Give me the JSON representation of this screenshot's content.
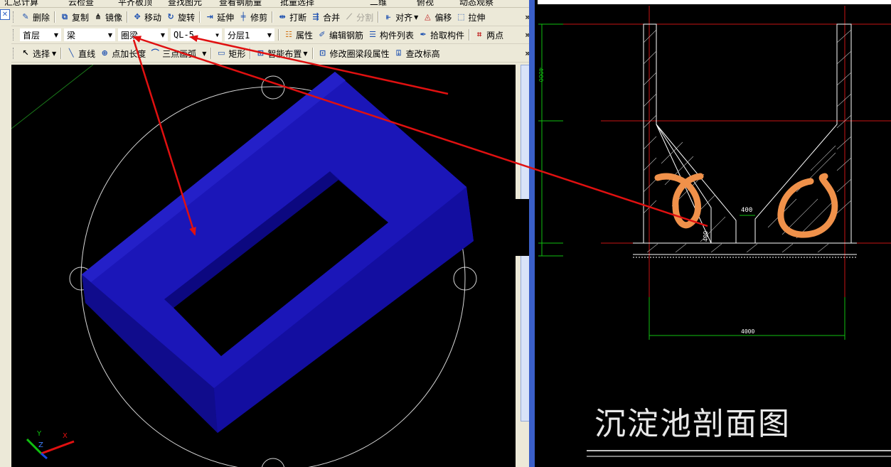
{
  "toolbar_cut": {
    "item1": "汇总计算",
    "item2": "云检查",
    "item3": "平齐板顶",
    "item4": "查找图元",
    "item5": "查看钢筋量",
    "item6": "批量选择",
    "item7": "二维",
    "item8": "俯视",
    "item9": "动态观察"
  },
  "toolbar1": {
    "delete": "删除",
    "copy": "复制",
    "mirror": "镜像",
    "move": "移动",
    "rotate": "旋转",
    "extend": "延伸",
    "trim": "修剪",
    "break": "打断",
    "merge": "合并",
    "split": "分割",
    "align": "对齐",
    "offset": "偏移",
    "stretch": "拉伸"
  },
  "toolbar2": {
    "floor": "首层",
    "category": "梁",
    "type": "圈梁",
    "component": "QL-5",
    "layer": "分层1",
    "properties": "属性",
    "edit_rebar": "编辑钢筋",
    "component_list": "构件列表",
    "pick_component": "拾取构件",
    "two_points": "两点"
  },
  "toolbar3": {
    "select": "选择",
    "line": "直线",
    "point_length": "点加长度",
    "three_point_arc": "三点画弧",
    "rectangle": "矩形",
    "smart_layout": "智能布置",
    "modify_ring_beam": "修改圈梁段属性",
    "check_elevation": "查改标高"
  },
  "axes": {
    "x": "X",
    "y": "Y",
    "z": "Z"
  },
  "drawing": {
    "caption": "沉淀池剖面图",
    "dim_top": "400",
    "dim_side": "400",
    "dim_bottom": "4000",
    "dim_left": "4000"
  },
  "colors": {
    "beam": "#1510a8",
    "annotation_red": "#e01010",
    "highlight_orange": "#f0914a",
    "cad_green": "#10c010",
    "cad_red": "#c81414"
  }
}
